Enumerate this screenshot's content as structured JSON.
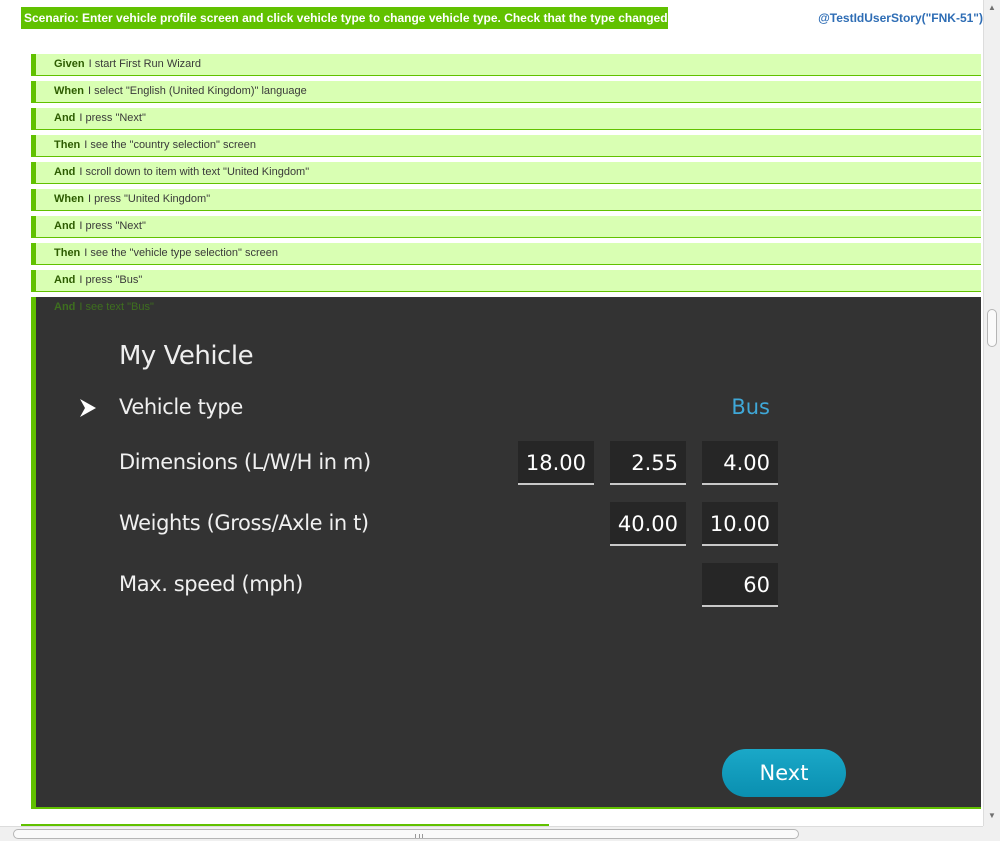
{
  "scenario": {
    "title": "Scenario: Enter vehicle profile screen and click vehicle type to change vehicle type. Check that the type changed",
    "story_tag": "@TestIdUserStory(\"FNK-51\")"
  },
  "steps": [
    {
      "keyword": "Given",
      "text": "I start First Run Wizard"
    },
    {
      "keyword": "When",
      "text": "I select \"English (United Kingdom)\" language"
    },
    {
      "keyword": "And",
      "text": "I press \"Next\""
    },
    {
      "keyword": "Then",
      "text": "I see the \"country selection\" screen"
    },
    {
      "keyword": "And",
      "text": "I scroll down to item with text \"United Kingdom\""
    },
    {
      "keyword": "When",
      "text": "I press \"United Kingdom\""
    },
    {
      "keyword": "And",
      "text": "I press \"Next\""
    },
    {
      "keyword": "Then",
      "text": "I see the \"vehicle type selection\" screen"
    },
    {
      "keyword": "And",
      "text": "I press \"Bus\""
    }
  ],
  "last_step": {
    "keyword": "And",
    "text": "I see text \"Bus\""
  },
  "device": {
    "title": "My Vehicle",
    "vehicle_type_label": "Vehicle type",
    "vehicle_type_value": "Bus",
    "dimensions_label": "Dimensions (L/W/H in m)",
    "dimensions": {
      "length": "18.00",
      "width": "2.55",
      "height": "4.00"
    },
    "weights_label": "Weights (Gross/Axle in t)",
    "weights": {
      "gross": "40.00",
      "axle": "10.00"
    },
    "speed_label": "Max. speed (mph)",
    "speed": "60",
    "next_label": "Next"
  },
  "progress": {
    "fraction": 0.55
  },
  "colors": {
    "accent": "#61c100",
    "step_bg": "#d9ffb3",
    "link": "#2e6db5",
    "device_bg": "#333333",
    "value_blue": "#3fa8d8",
    "button": "#0a9cbd"
  }
}
